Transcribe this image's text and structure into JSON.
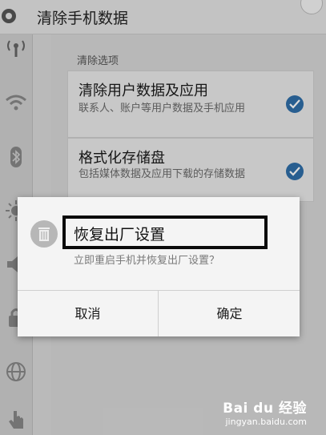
{
  "header": {
    "title": "清除手机数据"
  },
  "content": {
    "section_title": "清除选项",
    "options": [
      {
        "title": "清除用户数据及应用",
        "subtitle": "联系人、账户等用户数据及手机应用",
        "checked": true
      },
      {
        "title": "格式化存储盘",
        "subtitle": "包括媒体数据及应用下载的存储数据",
        "checked": true
      }
    ]
  },
  "dialog": {
    "title": "恢复出厂设置",
    "message": "立即重启手机并恢复出厂设置？",
    "cancel_label": "取消",
    "confirm_label": "确定"
  },
  "watermark": {
    "logo": "Bai du 经验",
    "url": "jingyan.baidu.com"
  },
  "sidebar_icons": [
    "signal-icon",
    "wifi-icon",
    "bluetooth-icon",
    "brightness-icon",
    "volume-icon",
    "lock-icon",
    "globe-icon",
    "hand-icon"
  ],
  "colors": {
    "accent": "#2f6ea8",
    "highlight_border": "#0a0a0a"
  }
}
